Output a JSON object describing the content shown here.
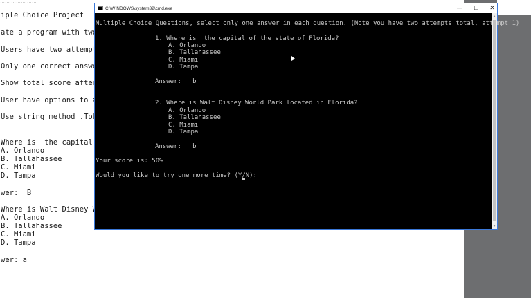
{
  "document": {
    "top_fragment": "…… ……… ……",
    "lines": [
      "iple Choice Project",
      "ate a program with two m",
      "Users have two attempts",
      "Only one correct answer",
      "Show total score after t",
      "User have options to ans",
      "Use string method .ToUpp",
      "Where is  the capital of",
      "A. Orlando",
      "B. Tallahassee",
      "C. Miami",
      "D. Tampa",
      "wer:  B",
      "Where is Walt Disney Wor",
      "A. Orlando",
      "B. Tallahassee",
      "C. Miami",
      "D. Tampa",
      "wer: a"
    ]
  },
  "console": {
    "title": "C:\\WINDOWS\\system32\\cmd.exe",
    "buttons": {
      "minimize": "—",
      "maximize": "☐",
      "close": "✕"
    },
    "lines": [
      "Multiple Choice Questions, select only one answer in each question. (Note you have two attempts total, attempt 1)",
      "1. Where is  the capital of the state of Florida?",
      "A. Orlando",
      "B. Tallahassee",
      "C. Miami",
      "D. Tampa",
      "Answer:   b",
      "2. Where is Walt Disney World Park located in Florida?",
      "A. Orlando",
      "B. Tallahassee",
      "C. Miami",
      "D. Tampa",
      "Answer:   b",
      "Your score is: 50%",
      "Would you like to try one more time? (Y/N): "
    ]
  },
  "colors": {
    "console_bg": "#000000",
    "console_text": "#c8c8c8",
    "window_border": "#3b78d8",
    "side_panel": "#6d6e70"
  },
  "icons": [
    "cmd-icon",
    "minimize-icon",
    "maximize-icon",
    "close-icon",
    "mouse-pointer-icon"
  ]
}
